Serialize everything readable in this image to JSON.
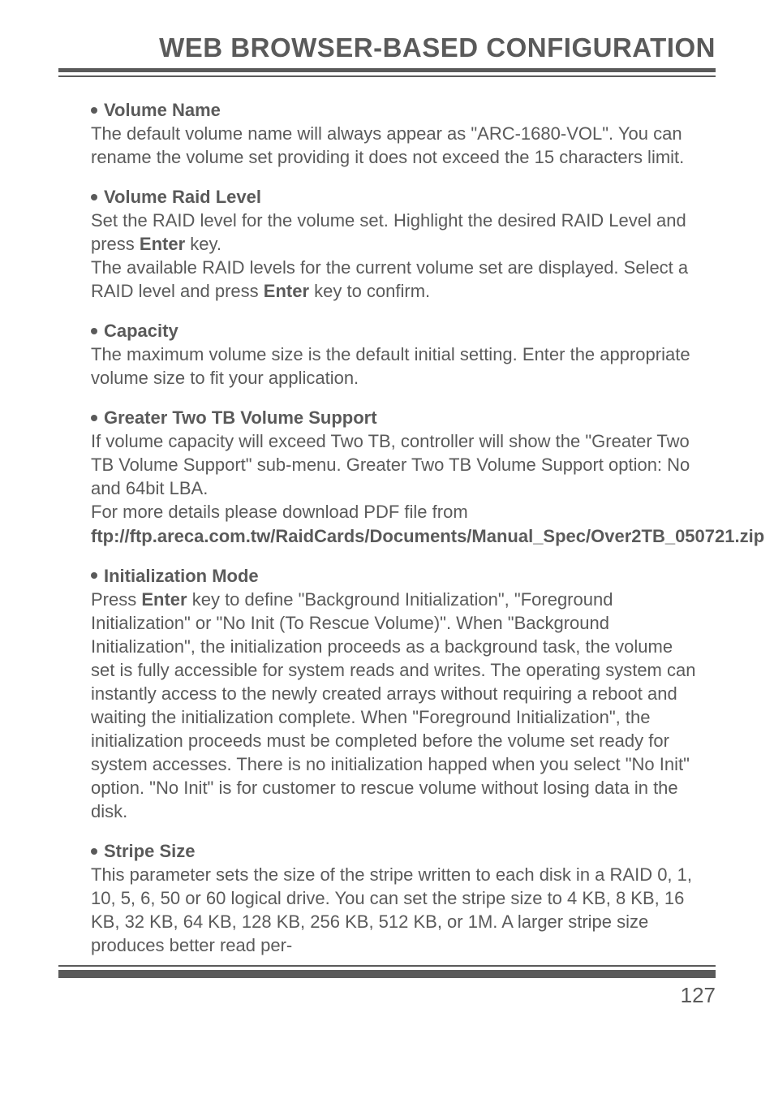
{
  "header": "WEB BROWSER-BASED CONFIGURATION",
  "sections": {
    "volumeName": {
      "title": "Volume Name",
      "body": "The default volume name will always appear as \"ARC-1680-VOL\". You can rename the volume set providing it does not exceed the 15 characters limit."
    },
    "volumeRaidLevel": {
      "title": "Volume Raid Level",
      "line1a": "Set the RAID level for the volume set. Highlight the desired RAID Level and press ",
      "enter1": "Enter",
      "line1b": " key.",
      "line2a": "The available RAID levels for the current volume set are displayed. Select a RAID level and press ",
      "enter2": "Enter",
      "line2b": " key to confirm."
    },
    "capacity": {
      "title": "Capacity",
      "body": "The maximum volume size is the default initial setting. Enter the appropriate volume size to fit your application."
    },
    "greaterTwoTB": {
      "title": "Greater Two TB Volume Support",
      "body": "If volume capacity will exceed Two TB, controller will show the \"Greater Two TB Volume Support\" sub-menu. Greater Two TB Volume Support option: No and 64bit LBA.",
      "link_intro": "For more details please download PDF file from ",
      "link": "ftp://ftp.areca.com.tw/RaidCards/Documents/Manual_Spec/Over2TB_050721.zip"
    },
    "initMode": {
      "title": "Initialization Mode",
      "pre": "Press ",
      "enter": "Enter",
      "post": " key to define \"Background Initialization\", \"Foreground Initialization\" or \"No Init (To Rescue Volume)\". When \"Background Initialization\", the initialization proceeds as a background task, the volume set is fully accessible for system reads and writes. The operating system can instantly access to the newly created arrays without requiring a reboot and waiting the initialization complete. When \"Foreground Initialization\", the initialization proceeds must be completed before the volume set ready for system accesses. There is no initialization happed when you select \"No Init\" option. \"No Init\" is for customer to rescue volume without losing data in the disk."
    },
    "stripeSize": {
      "title": "Stripe Size",
      "body": "This parameter sets the size of the stripe written to each disk in a RAID 0, 1, 10, 5, 6, 50 or 60 logical drive. You can set the stripe size to 4 KB, 8 KB, 16 KB, 32 KB, 64 KB, 128 KB, 256 KB, 512 KB, or 1M. A larger stripe size produces better read per-"
    }
  },
  "pageNumber": "127"
}
